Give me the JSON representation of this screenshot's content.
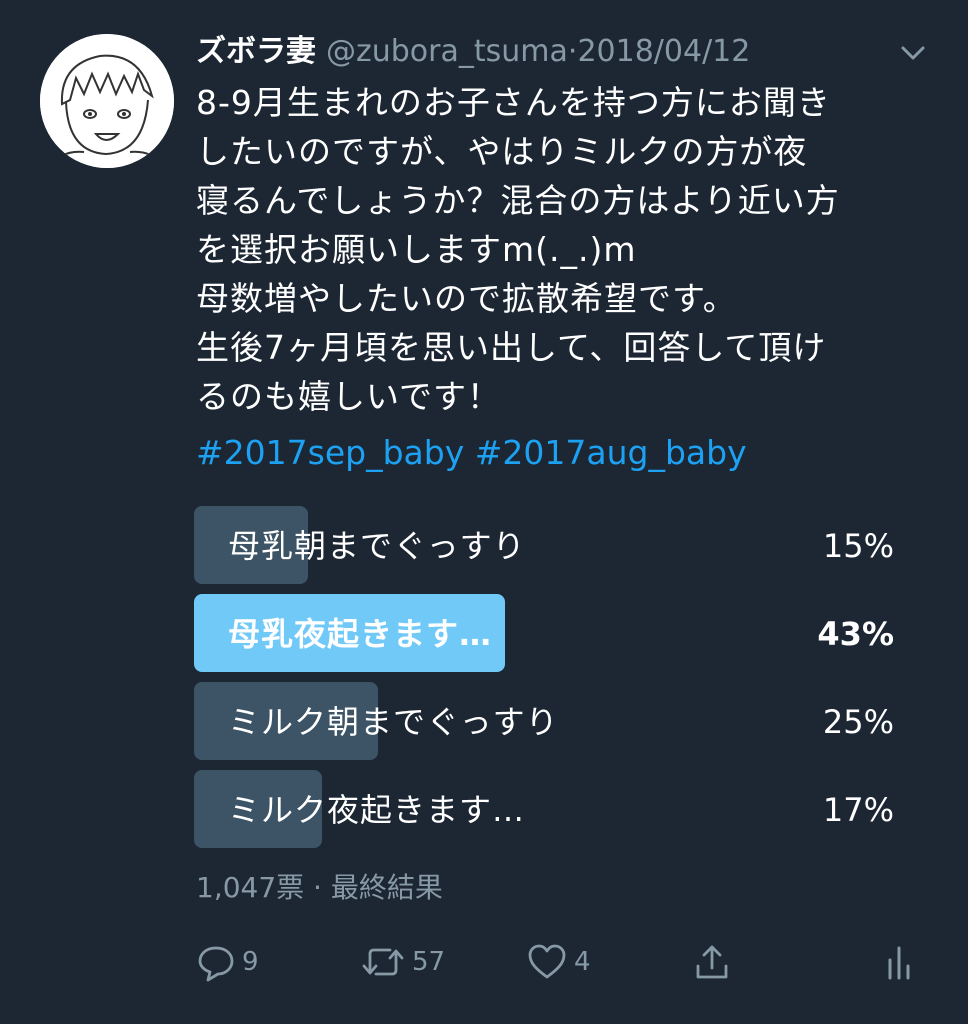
{
  "tweet": {
    "display_name": "ズボラ妻",
    "handle": "@zubora_tsuma",
    "separator": "·",
    "date": "2018/04/12",
    "body_lines": [
      "8-9月生まれのお子さんを持つ方にお聞き",
      "したいのですが、やはりミルクの方が夜",
      "寝るんでしょうか？混合の方はより近い方",
      "を選択お願いしますm(._.)m",
      "母数増やしたいので拡散希望です。",
      "生後7ヶ月頃を思い出して、回答して頂け",
      "るのも嬉しいです！"
    ],
    "hashtags": [
      "#2017sep_baby",
      "#2017aug_baby"
    ]
  },
  "poll": {
    "options": [
      {
        "label": "母乳朝までぐっすり",
        "percent_text": "15%",
        "percent": 15,
        "winner": false
      },
      {
        "label": "母乳夜起きます…",
        "percent_text": "43%",
        "percent": 43,
        "winner": true
      },
      {
        "label": "ミルク朝までぐっすり",
        "percent_text": "25%",
        "percent": 25,
        "winner": false
      },
      {
        "label": "ミルク夜起きます…",
        "percent_text": "17%",
        "percent": 17,
        "winner": false
      }
    ],
    "meta": "1,047票 · 最終結果"
  },
  "actions": {
    "reply_count": "9",
    "retweet_count": "57",
    "like_count": "4",
    "icons": [
      "reply-icon",
      "retweet-icon",
      "like-icon",
      "share-icon",
      "analytics-icon"
    ]
  },
  "colors": {
    "background": "#1c2733",
    "accent": "#1da1f2",
    "poll_winner": "#71c9f8",
    "poll_bar": "#3d5466",
    "muted": "#8899a6"
  }
}
